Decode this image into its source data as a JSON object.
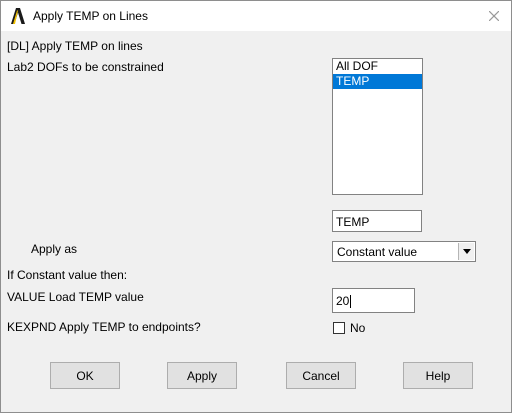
{
  "window": {
    "title": "Apply TEMP on Lines",
    "app_icon": "ansys-logo-icon",
    "close_icon": "close-icon"
  },
  "form": {
    "header": "[DL]  Apply TEMP on lines",
    "lab2_label": "Lab2   DOFs to be constrained",
    "dof_list": {
      "items": [
        "All DOF",
        "TEMP"
      ],
      "selected": "TEMP"
    },
    "dof_selection_value": "TEMP",
    "apply_as_label": "Apply as",
    "apply_as_value": "Constant value",
    "if_constant_label": "If Constant value then:",
    "value_label": "VALUE  Load TEMP value",
    "value_input": "20",
    "kexpnd_label": "KEXPND  Apply TEMP to endpoints?",
    "kexpnd_checkbox_label": "No",
    "kexpnd_checked": false
  },
  "buttons": {
    "ok": "OK",
    "apply": "Apply",
    "cancel": "Cancel",
    "help": "Help"
  },
  "colors": {
    "selection": "#0078d7",
    "logo": "#f5c400"
  }
}
